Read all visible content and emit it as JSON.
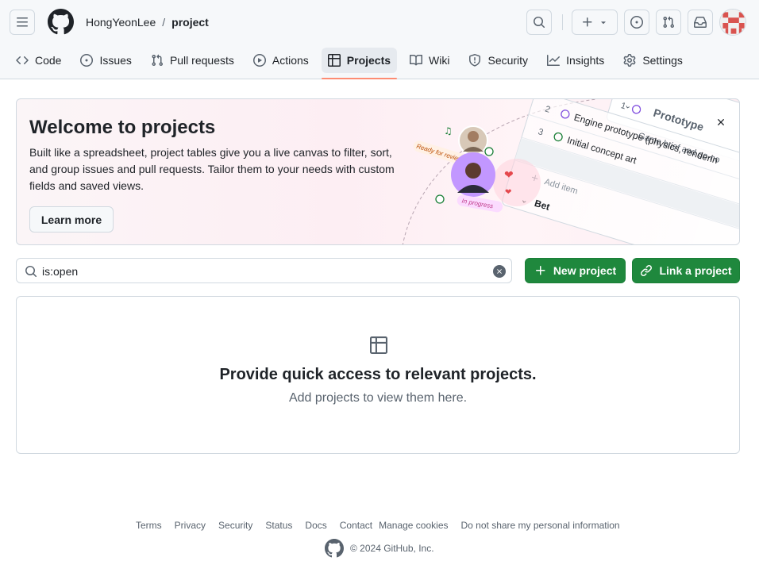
{
  "header": {
    "owner": "HongYeonLee",
    "separator": "/",
    "repo": "project"
  },
  "tabs": [
    {
      "label": "Code",
      "icon": "code-icon"
    },
    {
      "label": "Issues",
      "icon": "issue-opened-icon"
    },
    {
      "label": "Pull requests",
      "icon": "git-pull-request-icon"
    },
    {
      "label": "Actions",
      "icon": "play-icon"
    },
    {
      "label": "Projects",
      "icon": "table-icon",
      "active": true
    },
    {
      "label": "Wiki",
      "icon": "book-icon"
    },
    {
      "label": "Security",
      "icon": "shield-icon"
    },
    {
      "label": "Insights",
      "icon": "graph-icon"
    },
    {
      "label": "Settings",
      "icon": "gear-icon"
    }
  ],
  "banner": {
    "title": "Welcome to projects",
    "description": "Built like a spreadsheet, project tables give you a live canvas to filter, sort, and group issues and pull requests. Tailor them to your needs with custom fields and saved views.",
    "learn_more": "Learn more",
    "illustration": {
      "board_title": "Prototype",
      "rows": [
        {
          "num": "1",
          "text": "Game brief and go-no"
        },
        {
          "num": "2",
          "text": "Engine prototype (physics, renderin"
        },
        {
          "num": "3",
          "text": "Initial concept art"
        }
      ],
      "add_item": "Add item",
      "next_group": "Bet",
      "tag_review": "Ready for review",
      "tag_progress": "In progress"
    }
  },
  "filter": {
    "value": "is:open"
  },
  "buttons": {
    "new_project": "New project",
    "link_project": "Link a project"
  },
  "empty_state": {
    "title": "Provide quick access to relevant projects.",
    "subtitle": "Add projects to view them here."
  },
  "footer": {
    "links": [
      "Terms",
      "Privacy",
      "Security",
      "Status",
      "Docs",
      "Contact",
      "Manage cookies",
      "Do not share my personal information"
    ],
    "copyright": "© 2024 GitHub, Inc."
  },
  "colors": {
    "accent_green": "#1f883d",
    "active_tab_underline": "#fd8c73",
    "muted_text": "#59636e",
    "border": "#d1d9e0"
  }
}
